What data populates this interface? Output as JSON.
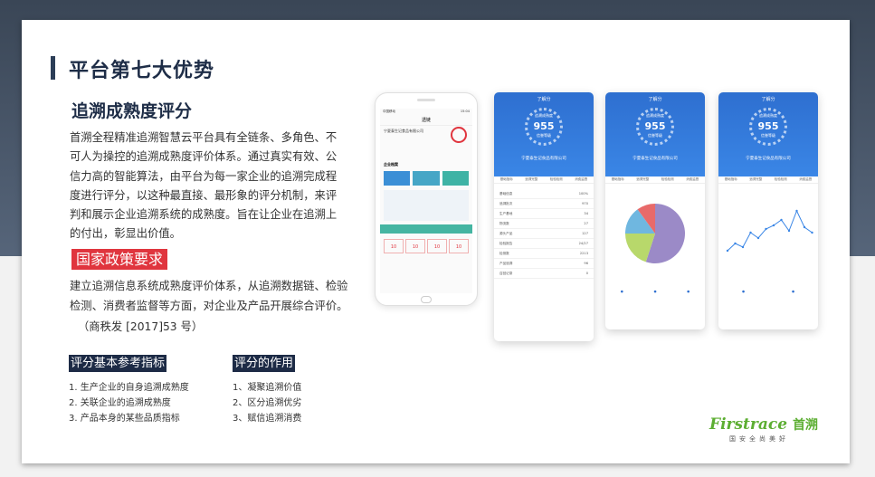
{
  "title": "平台第七大优势",
  "subtitle": "追溯成熟度评分",
  "intro": "首溯全程精准追溯智慧云平台具有全链条、多角色、不可人为操控的追溯成熟度评价体系。通过真实有效、公信力高的智能算法，由平台为每一家企业的追溯完成程度进行评分，以这种最直接、最形象的评分机制，来评判和展示企业追溯系统的成熟度。旨在让企业在追溯上的付出，彰显出价值。",
  "policy_tag": "国家政策要求",
  "policy_text": "建立追溯信息系统成熟度评价体系，从追溯数据链、检验检测、消费者监督等方面，对企业及产品开展综合评价。",
  "policy_ref": "（商秩发 [2017]53 号）",
  "indicators": {
    "header": "评分基本参考指标",
    "items": [
      "1. 生产企业的自身追溯成熟度",
      "2. 关联企业的追溯成熟度",
      "3. 产品本身的某些品质指标"
    ]
  },
  "effects": {
    "header": "评分的作用",
    "items": [
      "1、凝聚追溯价值",
      "2、区分追溯优劣",
      "3、赋信追溯消费"
    ]
  },
  "phone": {
    "status": "中国移动",
    "time": "15:04",
    "nav": "透链",
    "company": "宁夏泰生记食品有限公司",
    "section": "企业档案",
    "score": "10"
  },
  "mobile": {
    "title": "了解分",
    "gauge_label": "追溯成熟度",
    "score": "955",
    "level": "信誉等级",
    "company": "宁夏泰生记食品有限公司",
    "tabs": [
      "基础指标",
      "追溯完整",
      "检验检测",
      "消费监督",
      "用户评价"
    ],
    "rows": [
      [
        "基础信息",
        "100%"
      ],
      [
        "追溯批次",
        "970"
      ],
      [
        "生产基地",
        "34"
      ],
      [
        "物流数",
        "27"
      ],
      [
        "源头产品",
        "127"
      ],
      [
        "检验报告",
        "24/27"
      ],
      [
        "检测数",
        "2213"
      ],
      [
        "产品追溯",
        "96"
      ],
      [
        "召回记录",
        "0"
      ]
    ]
  },
  "chart_data": {
    "type": "pie",
    "values": [
      55,
      20,
      15,
      10
    ],
    "colors": [
      "#9b8ac7",
      "#b8d86b",
      "#6fb7e0",
      "#e86a6a"
    ]
  },
  "line_chart": {
    "type": "line",
    "values": [
      108,
      112,
      110,
      118,
      115,
      120,
      122,
      125,
      119,
      130,
      121,
      118
    ]
  },
  "logo": {
    "brand": "Firstrace",
    "cn": "首溯",
    "slogan": "国安全尚美好"
  }
}
